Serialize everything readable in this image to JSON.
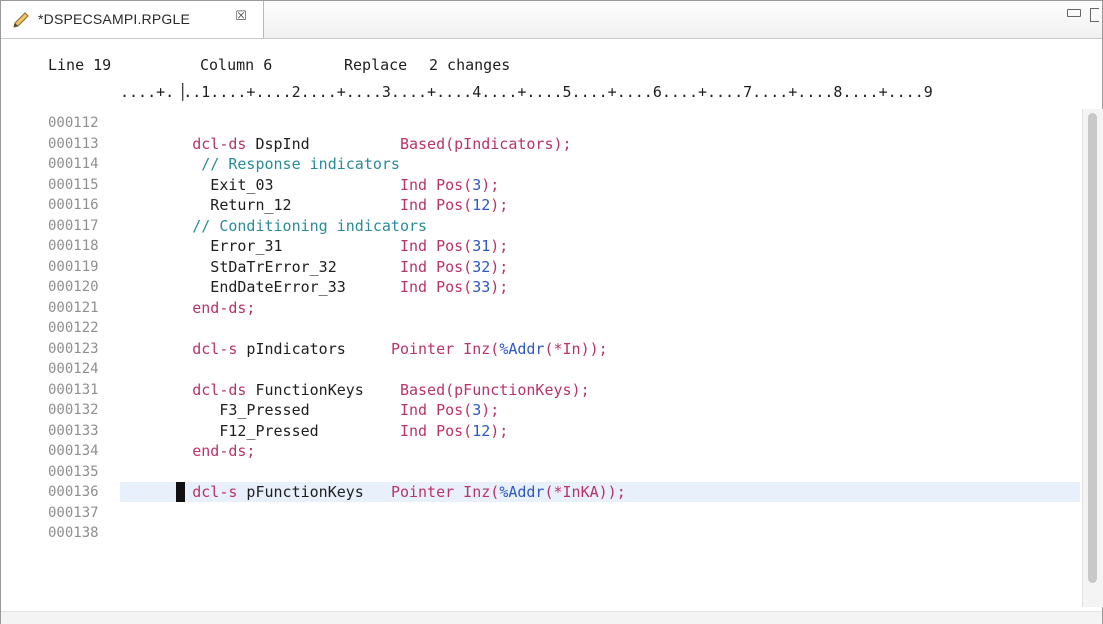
{
  "tab": {
    "title": "*DSPECSAMPI.RPGLE",
    "close_glyph": "☒"
  },
  "status": {
    "line": "Line 19",
    "column": "Column 6",
    "mode": "Replace",
    "changes": "2 changes"
  },
  "ruler": "....+.▕..1....+....2....+....3....+....4....+....5....+....6....+....7....+....8....+....9",
  "lines": [
    {
      "num": "000112",
      "tokens": []
    },
    {
      "num": "000113",
      "tokens": [
        {
          "t": "        ",
          "c": "pl"
        },
        {
          "t": "dcl-ds",
          "c": "kw"
        },
        {
          "t": " DspInd          ",
          "c": "pl"
        },
        {
          "t": "Based(pIndicators);",
          "c": "kw"
        }
      ]
    },
    {
      "num": "000114",
      "tokens": [
        {
          "t": "         ",
          "c": "pl"
        },
        {
          "t": "// Response indicators",
          "c": "cm"
        }
      ]
    },
    {
      "num": "000115",
      "tokens": [
        {
          "t": "          Exit_03              ",
          "c": "pl"
        },
        {
          "t": "Ind Pos(",
          "c": "kw"
        },
        {
          "t": "3",
          "c": "nm"
        },
        {
          "t": ");",
          "c": "kw"
        }
      ]
    },
    {
      "num": "000116",
      "tokens": [
        {
          "t": "          Return_12            ",
          "c": "pl"
        },
        {
          "t": "Ind Pos(",
          "c": "kw"
        },
        {
          "t": "12",
          "c": "nm"
        },
        {
          "t": ");",
          "c": "kw"
        }
      ]
    },
    {
      "num": "000117",
      "tokens": [
        {
          "t": "        ",
          "c": "pl"
        },
        {
          "t": "// Conditioning indicators",
          "c": "cm"
        }
      ]
    },
    {
      "num": "000118",
      "tokens": [
        {
          "t": "          Error_31             ",
          "c": "pl"
        },
        {
          "t": "Ind Pos(",
          "c": "kw"
        },
        {
          "t": "31",
          "c": "nm"
        },
        {
          "t": ");",
          "c": "kw"
        }
      ]
    },
    {
      "num": "000119",
      "tokens": [
        {
          "t": "          StDaTrError_32       ",
          "c": "pl"
        },
        {
          "t": "Ind Pos(",
          "c": "kw"
        },
        {
          "t": "32",
          "c": "nm"
        },
        {
          "t": ");",
          "c": "kw"
        }
      ]
    },
    {
      "num": "000120",
      "tokens": [
        {
          "t": "          EndDateError_33      ",
          "c": "pl"
        },
        {
          "t": "Ind Pos(",
          "c": "kw"
        },
        {
          "t": "33",
          "c": "nm"
        },
        {
          "t": ");",
          "c": "kw"
        }
      ]
    },
    {
      "num": "000121",
      "tokens": [
        {
          "t": "        ",
          "c": "pl"
        },
        {
          "t": "end-ds;",
          "c": "kw"
        }
      ]
    },
    {
      "num": "000122",
      "tokens": []
    },
    {
      "num": "000123",
      "tokens": [
        {
          "t": "        ",
          "c": "pl"
        },
        {
          "t": "dcl-s",
          "c": "kw"
        },
        {
          "t": " pIndicators     ",
          "c": "pl"
        },
        {
          "t": "Pointer Inz(",
          "c": "kw"
        },
        {
          "t": "%Addr",
          "c": "nm"
        },
        {
          "t": "(*In));",
          "c": "kw"
        }
      ]
    },
    {
      "num": "000124",
      "tokens": []
    },
    {
      "num": "000131",
      "tokens": [
        {
          "t": "        ",
          "c": "pl"
        },
        {
          "t": "dcl-ds",
          "c": "kw"
        },
        {
          "t": " FunctionKeys    ",
          "c": "pl"
        },
        {
          "t": "Based(pFunctionKeys);",
          "c": "kw"
        }
      ]
    },
    {
      "num": "000132",
      "tokens": [
        {
          "t": "           F3_Pressed          ",
          "c": "pl"
        },
        {
          "t": "Ind Pos(",
          "c": "kw"
        },
        {
          "t": "3",
          "c": "nm"
        },
        {
          "t": ");",
          "c": "kw"
        }
      ]
    },
    {
      "num": "000133",
      "tokens": [
        {
          "t": "           F12_Pressed         ",
          "c": "pl"
        },
        {
          "t": "Ind Pos(",
          "c": "kw"
        },
        {
          "t": "12",
          "c": "nm"
        },
        {
          "t": ");",
          "c": "kw"
        }
      ]
    },
    {
      "num": "000134",
      "tokens": [
        {
          "t": "        ",
          "c": "pl"
        },
        {
          "t": "end-ds;",
          "c": "kw"
        }
      ]
    },
    {
      "num": "000135",
      "tokens": []
    },
    {
      "num": "000136",
      "current": true,
      "tokens": [
        {
          "t": "        ",
          "c": "pl"
        },
        {
          "t": "dcl-s",
          "c": "kw"
        },
        {
          "t": " pFunctionKeys   ",
          "c": "pl"
        },
        {
          "t": "Pointer Inz(",
          "c": "kw"
        },
        {
          "t": "%Addr",
          "c": "nm"
        },
        {
          "t": "(*InKA));",
          "c": "kw"
        }
      ]
    },
    {
      "num": "000137",
      "tokens": []
    },
    {
      "num": "000138",
      "tokens": []
    }
  ],
  "colors": {
    "keyword": "#b8336a",
    "comment": "#2a8b99",
    "number": "#2f56c7",
    "current_line": "#e8f0fb"
  },
  "icons": {
    "tab_icon": "pencil-icon",
    "minimize": "minimize-icon",
    "maximize": "maximize-icon"
  }
}
